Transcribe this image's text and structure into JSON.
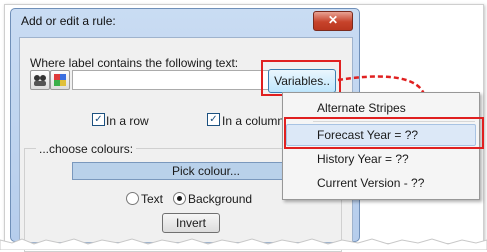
{
  "dialog": {
    "title": "Add or edit a rule:",
    "close_glyph": "✕",
    "label_text": "Where label contains the following text:",
    "text_value": "",
    "variables_label": "Variables..",
    "in_a_row_label": "In a row",
    "in_a_column_label": "In a column",
    "in_a_row_checked": true,
    "in_a_column_checked": true,
    "colours_label": "...choose colours:",
    "pick_colour_label": "Pick colour...",
    "radio_text_label": "Text",
    "radio_background_label": "Background",
    "radio_selected": "Background",
    "invert_label": "Invert"
  },
  "menu": {
    "items": [
      {
        "label": "Alternate Stripes"
      },
      {
        "label": "Forecast Year = ??"
      },
      {
        "label": "History Year = ??"
      },
      {
        "label": "Current Version - ??"
      }
    ],
    "highlighted": "Forecast Year = ??"
  },
  "colors": {
    "highlight_red": "#e02020",
    "titlebar": "#c9dcf3",
    "pick_colour_bg": "#b9d1ea"
  },
  "icons": [
    "people-icon",
    "colour-swatch-icon",
    "dashed-arrow-icon"
  ]
}
